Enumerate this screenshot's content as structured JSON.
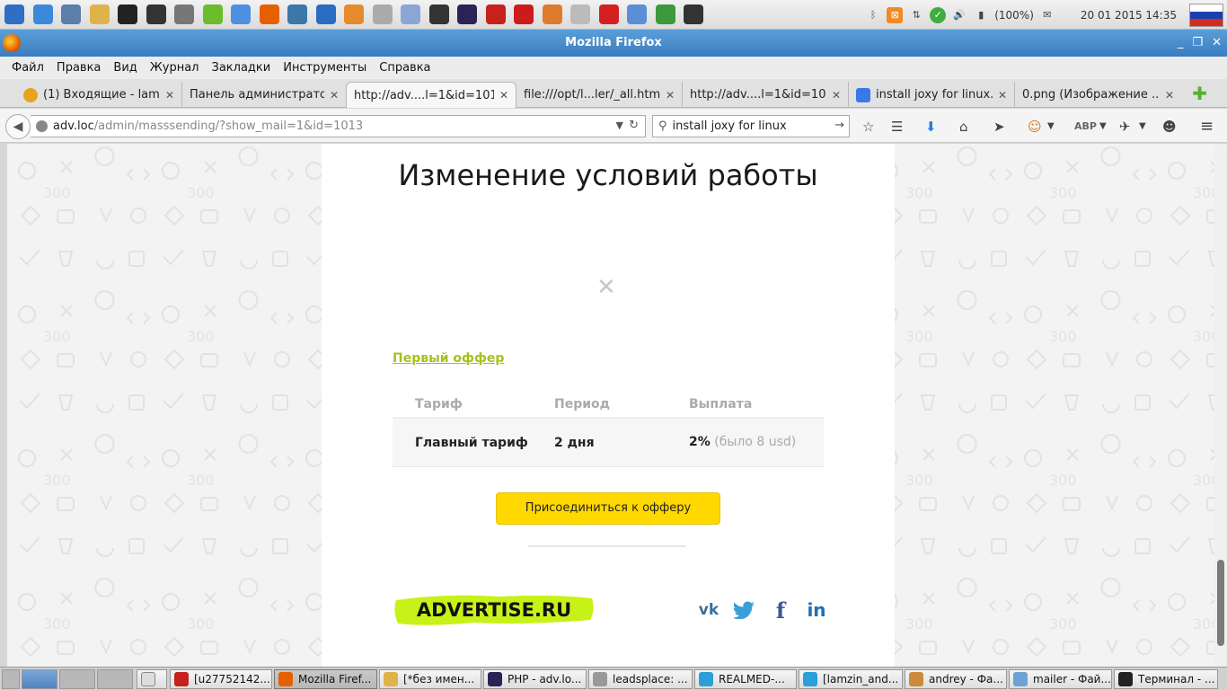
{
  "system_panel": {
    "battery": "(100%)",
    "clock": "20 01 2015 14:35",
    "launchers": [
      {
        "icon": "kde-menu-icon",
        "color": "#2e6fc4"
      },
      {
        "icon": "download-manager-icon",
        "color": "#3b8ad9"
      },
      {
        "icon": "postgresql-elephant-icon",
        "color": "#5a7fa8"
      },
      {
        "icon": "gnome-icon",
        "color": "#e0b34a"
      },
      {
        "icon": "xfce-mouse-icon",
        "color": "#222"
      },
      {
        "icon": "terminal-icon",
        "color": "#333"
      },
      {
        "icon": "database-icon",
        "color": "#777"
      },
      {
        "icon": "play-icon",
        "color": "#6cbd2c"
      },
      {
        "icon": "chromium-icon",
        "color": "#4d8fe0"
      },
      {
        "icon": "firefox-icon",
        "color": "#e66000"
      },
      {
        "icon": "python-icon",
        "color": "#3b77a8"
      },
      {
        "icon": "system-monitor-icon",
        "color": "#2a6cc1"
      },
      {
        "icon": "wifi-icon",
        "color": "#e68a2e"
      },
      {
        "icon": "text-editor-icon",
        "color": "#aaa"
      },
      {
        "icon": "microphone-icon",
        "color": "#8aa6d6"
      },
      {
        "icon": "monitor-graph-icon",
        "color": "#333"
      },
      {
        "icon": "eclipse-icon",
        "color": "#2c2255"
      },
      {
        "icon": "filezilla-icon",
        "color": "#c4221a"
      },
      {
        "icon": "opera-icon",
        "color": "#cc1b1b"
      },
      {
        "icon": "swirl-app-icon",
        "color": "#e07a2c"
      },
      {
        "icon": "clock-icon",
        "color": "#bbb"
      },
      {
        "icon": "stop-icon",
        "color": "#d42020"
      },
      {
        "icon": "chat-bubbles-icon",
        "color": "#5b8ed6"
      },
      {
        "icon": "plus-minus-icon",
        "color": "#3c9a3c"
      },
      {
        "icon": "xfce-icon",
        "color": "#333"
      }
    ]
  },
  "window": {
    "title": "Mozilla Firefox",
    "buttons": [
      "_",
      "❐",
      "✕"
    ]
  },
  "menu": [
    "Файл",
    "Правка",
    "Вид",
    "Журнал",
    "Закладки",
    "Инструменты",
    "Справка"
  ],
  "tabs": [
    {
      "label": "(1) Входящие - lam...",
      "favicon": "#e8a31c"
    },
    {
      "label": "Панель администрато...",
      "favicon": ""
    },
    {
      "label": "http://adv....l=1&id=1013",
      "favicon": "",
      "active": true
    },
    {
      "label": "file:///opt/l...ler/_all.html",
      "favicon": ""
    },
    {
      "label": "http://adv....l=1&id=1013",
      "favicon": ""
    },
    {
      "label": "install joxy for linux...",
      "favicon": "#3b78e7"
    },
    {
      "label": "0.png (Изображение ...",
      "favicon": ""
    }
  ],
  "nav": {
    "url_host": "adv.loc",
    "url_path": "/admin/masssending/?show_mail=1&id=1013",
    "search_value": "install joxy for linux"
  },
  "page": {
    "heading": "Изменение условий работы",
    "broken_image_glyph": "✕",
    "offer_link": "Первый оффер",
    "table": {
      "headers": [
        "Тариф",
        "Период",
        "Выплата"
      ],
      "row": {
        "tariff": "Главный тариф",
        "period": "2 дня",
        "payout": "2%",
        "was": "(было 8 usd)"
      }
    },
    "join_button": "Присоединиться к офферу",
    "logo_text": "ADVERTISE.RU",
    "social": [
      {
        "icon": "vk-icon",
        "glyph": "vk"
      },
      {
        "icon": "twitter-icon",
        "glyph": "🐦"
      },
      {
        "icon": "facebook-icon",
        "glyph": "f"
      },
      {
        "icon": "linkedin-icon",
        "glyph": "in"
      }
    ]
  },
  "taskbar": {
    "items": [
      {
        "label": "[u27752142...",
        "icon": "filezilla-icon",
        "color": "#c4221a"
      },
      {
        "label": "Mozilla Firef...",
        "icon": "firefox-icon",
        "color": "#e66000",
        "active": true
      },
      {
        "label": "[*без имен...",
        "icon": "text-editor-icon",
        "color": "#e0b34a"
      },
      {
        "label": "PHP - adv.lo...",
        "icon": "eclipse-icon",
        "color": "#2c2255"
      },
      {
        "label": "leadsplace: ...",
        "icon": "editor-icon",
        "color": "#999"
      },
      {
        "label": "REALMED-...",
        "icon": "chat-icon",
        "color": "#2aa0d8"
      },
      {
        "label": "[lamzin_and...",
        "icon": "skype-icon",
        "color": "#2aa0d8"
      },
      {
        "label": "andrey - Фа...",
        "icon": "home-folder-icon",
        "color": "#cc8a3a"
      },
      {
        "label": "mailer - Фай...",
        "icon": "folder-icon",
        "color": "#6ea2d6"
      },
      {
        "label": "Терминал - ...",
        "icon": "terminal-icon",
        "color": "#222"
      }
    ]
  }
}
